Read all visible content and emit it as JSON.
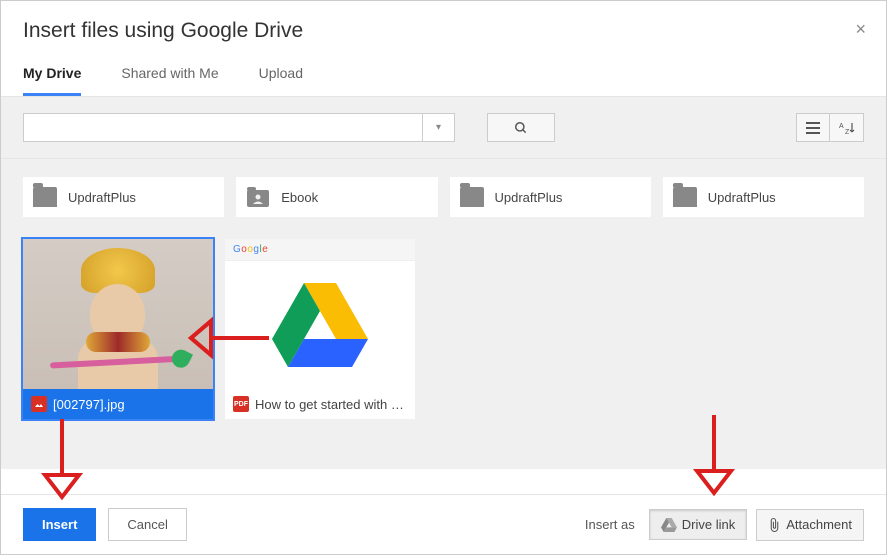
{
  "header": {
    "title": "Insert files using Google Drive",
    "close": "×"
  },
  "tabs": {
    "my_drive": "My Drive",
    "shared": "Shared with Me",
    "upload": "Upload"
  },
  "search": {
    "value": "",
    "dropdown_glyph": "▾"
  },
  "folders": [
    {
      "name": "UpdraftPlus",
      "icon_kind": "folder"
    },
    {
      "name": "Ebook",
      "icon_kind": "shared"
    },
    {
      "name": "UpdraftPlus",
      "icon_kind": "folder"
    },
    {
      "name": "UpdraftPlus",
      "icon_kind": "folder"
    }
  ],
  "files": {
    "selected_image_name": "[002797].jpg",
    "pdf_name": "How to get started with …"
  },
  "footer": {
    "insert": "Insert",
    "cancel": "Cancel",
    "insert_as_label": "Insert as",
    "drive_link": "Drive link",
    "attachment": "Attachment"
  }
}
